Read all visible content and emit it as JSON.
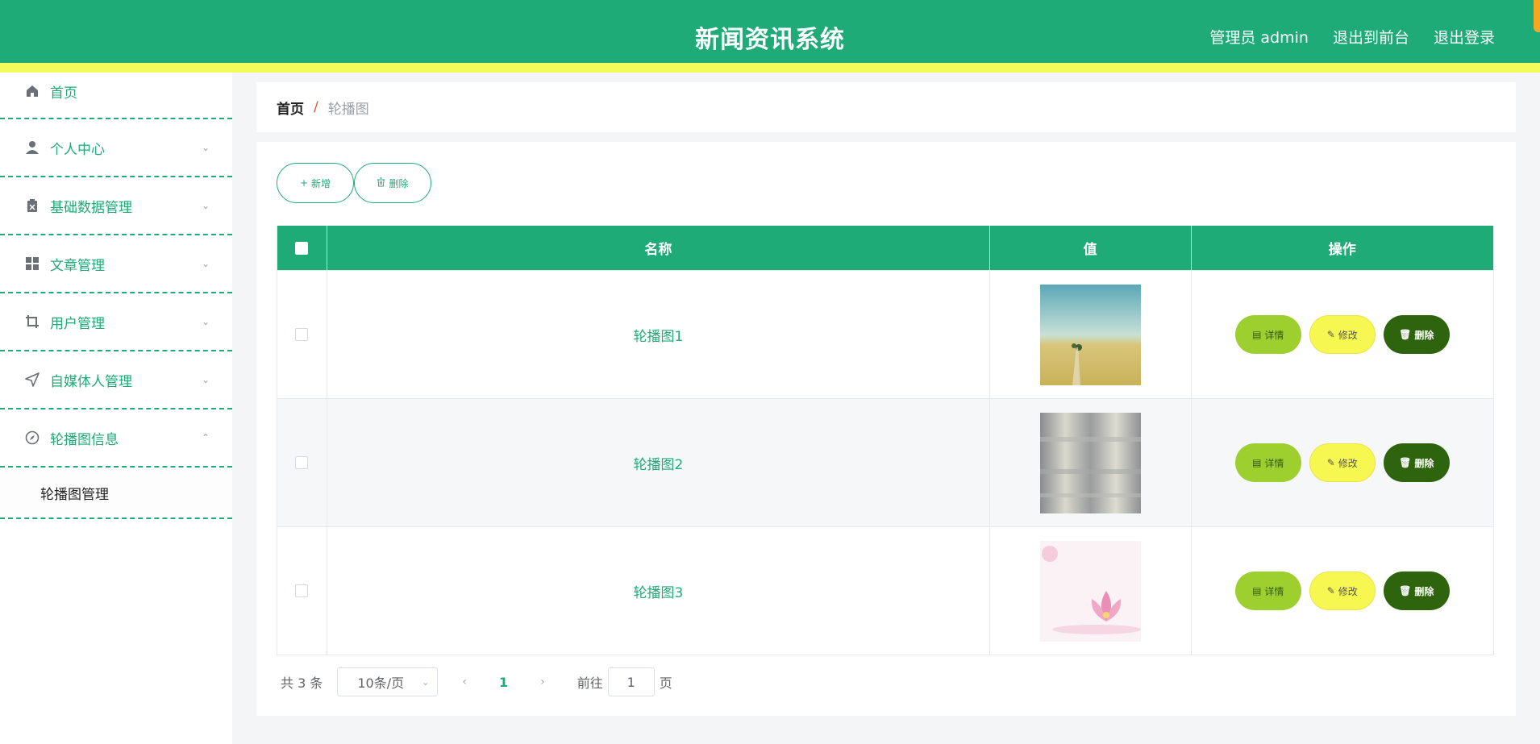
{
  "header": {
    "title": "新闻资讯系统",
    "nav": {
      "admin": "管理员 admin",
      "front": "退出到前台",
      "logout": "退出登录"
    }
  },
  "sidebar": {
    "items": [
      {
        "label": "首页",
        "icon": "home-icon"
      },
      {
        "label": "个人中心",
        "icon": "user-icon"
      },
      {
        "label": "基础数据管理",
        "icon": "clipboard-icon"
      },
      {
        "label": "文章管理",
        "icon": "grid-icon"
      },
      {
        "label": "用户管理",
        "icon": "crop-icon"
      },
      {
        "label": "自媒体人管理",
        "icon": "send-icon"
      },
      {
        "label": "轮播图信息",
        "icon": "compass-icon"
      }
    ],
    "submenu": "轮播图管理"
  },
  "breadcrumb": {
    "home": "首页",
    "separator": "/",
    "current": "轮播图"
  },
  "toolbar": {
    "add": "新增",
    "delete": "删除"
  },
  "table": {
    "headers": {
      "name": "名称",
      "value": "值",
      "actions": "操作"
    },
    "rows": [
      {
        "name": "轮播图1",
        "image": "field-landscape"
      },
      {
        "name": "轮播图2",
        "image": "grey-texture"
      },
      {
        "name": "轮播图3",
        "image": "lotus-flower"
      }
    ],
    "actions": {
      "detail": "详情",
      "edit": "修改",
      "delete": "删除"
    }
  },
  "pager": {
    "total": "共 3 条",
    "page_size": "10条/页",
    "current": "1",
    "goto": "前往",
    "goto_value": "1",
    "page_suffix": "页"
  },
  "colors": {
    "primary": "#1fab78",
    "accent": "#f3fb5a",
    "detail": "#9dcf2e",
    "edit": "#f7f751",
    "delete": "#2f640f"
  }
}
